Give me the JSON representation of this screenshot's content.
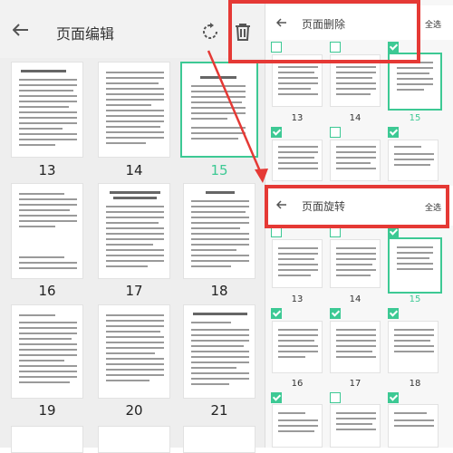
{
  "left_panel": {
    "title": "页面编辑",
    "icons": [
      "back-arrow-icon",
      "rotate-icon",
      "trash-icon"
    ],
    "pages": [
      "13",
      "14",
      "15",
      "16",
      "17",
      "18",
      "19",
      "20",
      "21"
    ],
    "selected_page": "15"
  },
  "delete_panel": {
    "title": "页面删除",
    "select_all": "全选",
    "pages": [
      "13",
      "14",
      "15"
    ],
    "selected_page": "15"
  },
  "rotate_panel": {
    "title": "页面旋转",
    "select_all": "全选",
    "pages": [
      "13",
      "14",
      "15",
      "16",
      "17",
      "18"
    ],
    "selected_page": "15"
  },
  "colors": {
    "accent": "#3dc994",
    "highlight": "#e53935"
  }
}
